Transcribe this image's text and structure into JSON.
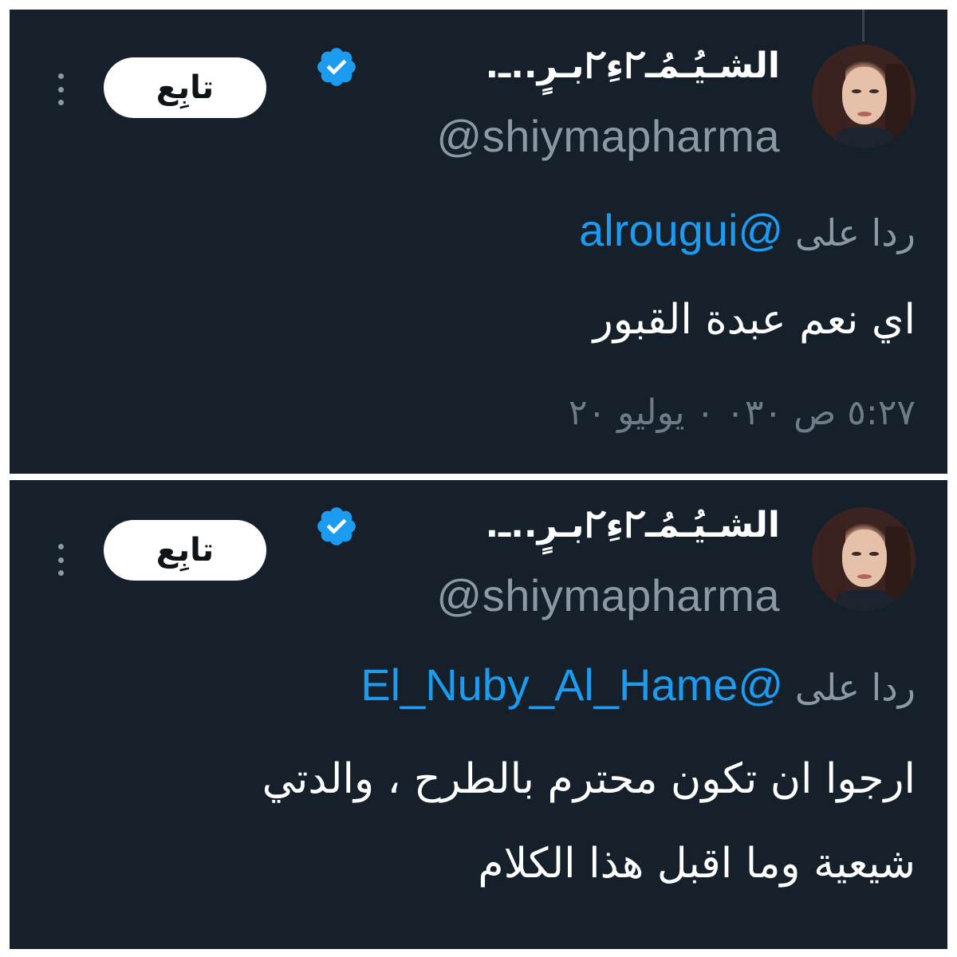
{
  "tweets": [
    {
      "display_name": "الشـيُـمُـ𐐊ءِ𐐊بـرٍ..ـ.",
      "handle": "@shiymapharma",
      "follow_label": "تابِع",
      "reply_prefix": "ردا على",
      "reply_to": "@alrougui",
      "text": "اي نعم عبدة القبور",
      "timestamp": "٥:٢٧ ص ٠٣٠ ٠ يوليو ٢٠"
    },
    {
      "display_name": "الشـيُـمُـ𐐊ءِ𐐊بـرٍ..ـ.",
      "handle": "@shiymapharma",
      "follow_label": "تابِع",
      "reply_prefix": "ردا على",
      "reply_to": "@El_Nuby_Al_Hame",
      "text_line1": "ارجوا ان تكون محترم بالطرح ، والدتي",
      "text_line2": "شيعية وما اقبل هذا الكلام"
    }
  ],
  "icons": {
    "verified": "verified-badge-icon",
    "more": "more-options-icon"
  },
  "colors": {
    "background": "#15202b",
    "accent": "#1d9bf0",
    "muted": "#8b98a5",
    "text": "#ffffff"
  }
}
